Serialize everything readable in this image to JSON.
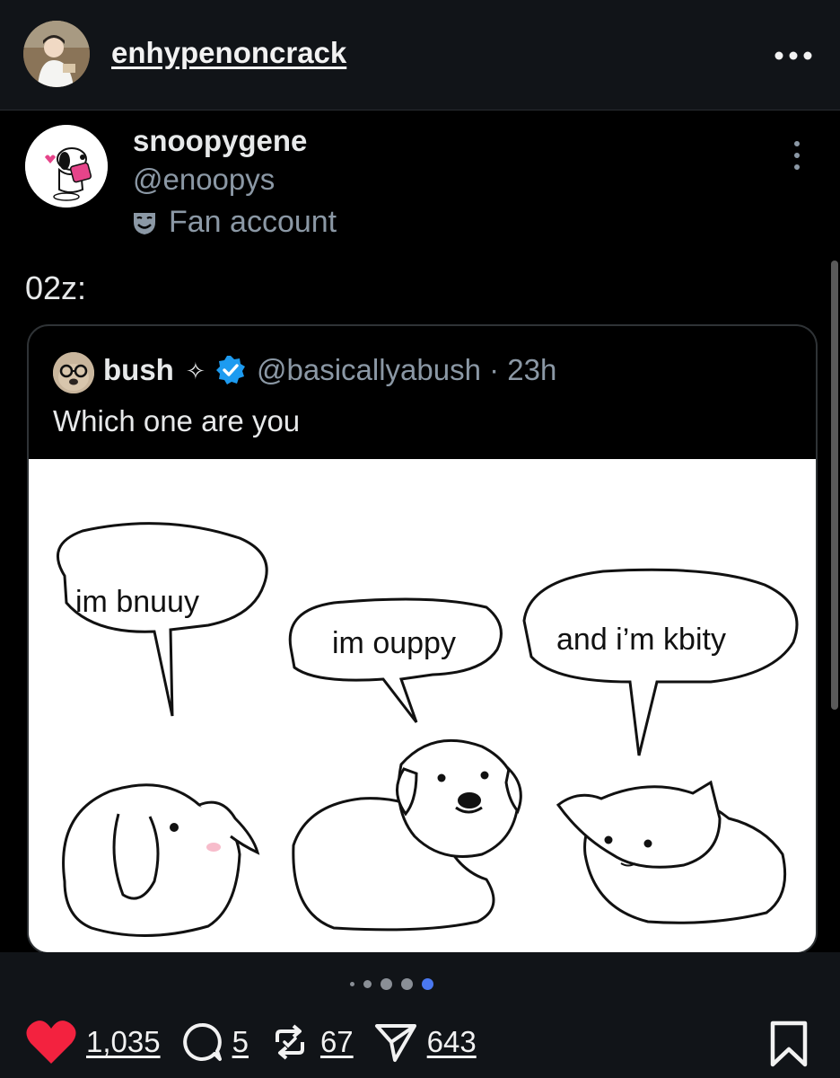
{
  "header": {
    "username": "enhypenoncrack",
    "more_icon": "more-horizontal-icon"
  },
  "post": {
    "display_name": "snoopygene",
    "handle": "@enoopys",
    "account_label": "Fan account",
    "account_label_icon": "theater-masks-icon",
    "text": "02z:"
  },
  "quoted": {
    "display_name": "bush",
    "name_emoji": "✧",
    "verified": true,
    "handle_time": "@basicallyabush · 23h",
    "text": "Which one are you",
    "image": {
      "bubble_1": "im bnuuy",
      "bubble_2": "im ouppy",
      "bubble_3": "and i’m kbity"
    }
  },
  "carousel": {
    "total": 5,
    "active_index": 4
  },
  "actions": {
    "likes": "1,035",
    "comments": "5",
    "reposts": "67",
    "shares": "643",
    "liked": true
  },
  "colors": {
    "like": "#f3223f",
    "verified": "#1d9bf0",
    "active_dot": "#4a78f0"
  }
}
